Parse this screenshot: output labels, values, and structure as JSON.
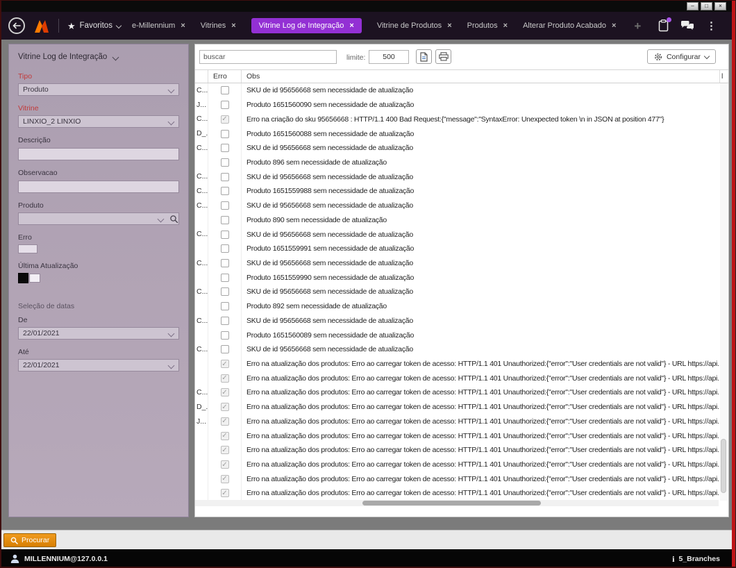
{
  "window": {
    "minimize": "–",
    "maximize": "□",
    "close": "×"
  },
  "colors": {
    "accent_purple": "#9330d4",
    "procurar_orange": "#e8890c",
    "edge_red": "#bd1518",
    "required_label_red": "#c23a3a"
  },
  "navbar": {
    "favorites_label": "Favoritos",
    "tabs": [
      {
        "label": "e-Millennium",
        "active": false
      },
      {
        "label": "Vitrines",
        "active": false
      },
      {
        "label": "Vitrine Log de Integração",
        "active": true
      },
      {
        "label": "Vitrine de Produtos",
        "active": false
      },
      {
        "label": "Produtos",
        "active": false
      },
      {
        "label": "Alterar Produto Acabado",
        "active": false
      }
    ],
    "add_tab": "+"
  },
  "sidebar": {
    "title": "Vitrine Log de Integração",
    "tipo": {
      "label": "Tipo",
      "value": "Produto"
    },
    "vitrine": {
      "label": "Vitrine",
      "value": "LINXIO_2 LINXIO"
    },
    "descricao": {
      "label": "Descrição",
      "value": ""
    },
    "observacao": {
      "label": "Observacao",
      "value": ""
    },
    "produto": {
      "label": "Produto",
      "value": ""
    },
    "erro": {
      "label": "Erro"
    },
    "ultima_atualizacao": {
      "label": "Última Atualização"
    },
    "date_section": {
      "title": "Seleção de datas",
      "de": {
        "label": "De",
        "value": "22/01/2021"
      },
      "ate": {
        "label": "Até",
        "value": "22/01/2021"
      }
    }
  },
  "toolbar": {
    "search_placeholder": "buscar",
    "limit_label": "limite:",
    "limit_value": "500",
    "configure_label": "Configurar"
  },
  "table": {
    "columns": {
      "c1": "",
      "erro": "Erro",
      "obs": "Obs",
      "right_stub": "l"
    },
    "rows": [
      {
        "c1": "C...",
        "erro": false,
        "obs": "SKU de id 95656668 sem necessidade de atualização"
      },
      {
        "c1": "J...",
        "erro": false,
        "obs": "Produto 1651560090 sem necessidade de atualização"
      },
      {
        "c1": "C...",
        "erro": true,
        "obs": "Erro na criação do sku 95656668 : HTTP/1.1 400 Bad Request:{\"message\":\"SyntaxError: Unexpected token \\n in JSON at position 477\"}"
      },
      {
        "c1": "D_...",
        "erro": false,
        "obs": "Produto 1651560088 sem necessidade de atualização"
      },
      {
        "c1": "C...",
        "erro": false,
        "obs": "SKU de id 95656668 sem necessidade de atualização"
      },
      {
        "c1": "",
        "erro": false,
        "obs": "Produto 896 sem necessidade de atualização"
      },
      {
        "c1": "C...",
        "erro": false,
        "obs": "SKU de id 95656668 sem necessidade de atualização"
      },
      {
        "c1": "C...",
        "erro": false,
        "obs": "Produto 1651559988 sem necessidade de atualização"
      },
      {
        "c1": "C...",
        "erro": false,
        "obs": "SKU de id 95656668 sem necessidade de atualização"
      },
      {
        "c1": "",
        "erro": false,
        "obs": "Produto 890 sem necessidade de atualização"
      },
      {
        "c1": "C...",
        "erro": false,
        "obs": "SKU de id 95656668 sem necessidade de atualização"
      },
      {
        "c1": "",
        "erro": false,
        "obs": "Produto 1651559991 sem necessidade de atualização"
      },
      {
        "c1": "C...",
        "erro": false,
        "obs": "SKU de id 95656668 sem necessidade de atualização"
      },
      {
        "c1": "",
        "erro": false,
        "obs": "Produto 1651559990 sem necessidade de atualização"
      },
      {
        "c1": "C...",
        "erro": false,
        "obs": "SKU de id 95656668 sem necessidade de atualização"
      },
      {
        "c1": "",
        "erro": false,
        "obs": "Produto 892 sem necessidade de atualização"
      },
      {
        "c1": "C...",
        "erro": false,
        "obs": "SKU de id 95656668 sem necessidade de atualização"
      },
      {
        "c1": "",
        "erro": false,
        "obs": "Produto 1651560089 sem necessidade de atualização"
      },
      {
        "c1": "C...",
        "erro": false,
        "obs": "SKU de id 95656668 sem necessidade de atualização"
      },
      {
        "c1": "",
        "erro": true,
        "obs": "Erro na atualização dos produtos: Erro ao carregar token de acesso: HTTP/1.1 401 Unauthorized:{\"error\":\"User credentials are not valid\"} - URL https://api.l..."
      },
      {
        "c1": "",
        "erro": true,
        "obs": "Erro na atualização dos produtos: Erro ao carregar token de acesso: HTTP/1.1 401 Unauthorized:{\"error\":\"User credentials are not valid\"} - URL https://api.l..."
      },
      {
        "c1": "C...",
        "erro": true,
        "obs": "Erro na atualização dos produtos: Erro ao carregar token de acesso: HTTP/1.1 401 Unauthorized:{\"error\":\"User credentials are not valid\"} - URL https://api.l..."
      },
      {
        "c1": "D_...",
        "erro": true,
        "obs": "Erro na atualização dos produtos: Erro ao carregar token de acesso: HTTP/1.1 401 Unauthorized:{\"error\":\"User credentials are not valid\"} - URL https://api.l..."
      },
      {
        "c1": "J...",
        "erro": true,
        "obs": "Erro na atualização dos produtos: Erro ao carregar token de acesso: HTTP/1.1 401 Unauthorized:{\"error\":\"User credentials are not valid\"} - URL https://api.l..."
      },
      {
        "c1": "",
        "erro": true,
        "obs": "Erro na atualização dos produtos: Erro ao carregar token de acesso: HTTP/1.1 401 Unauthorized:{\"error\":\"User credentials are not valid\"} - URL https://api.l..."
      },
      {
        "c1": "",
        "erro": true,
        "obs": "Erro na atualização dos produtos: Erro ao carregar token de acesso: HTTP/1.1 401 Unauthorized:{\"error\":\"User credentials are not valid\"} - URL https://api.l..."
      },
      {
        "c1": "",
        "erro": true,
        "obs": "Erro na atualização dos produtos: Erro ao carregar token de acesso: HTTP/1.1 401 Unauthorized:{\"error\":\"User credentials are not valid\"} - URL https://api.l..."
      },
      {
        "c1": "",
        "erro": true,
        "obs": "Erro na atualização dos produtos: Erro ao carregar token de acesso: HTTP/1.1 401 Unauthorized:{\"error\":\"User credentials are not valid\"} - URL https://api.l..."
      },
      {
        "c1": "",
        "erro": true,
        "obs": "Erro na atualização dos produtos: Erro ao carregar token de acesso: HTTP/1.1 401 Unauthorized:{\"error\":\"User credentials are not valid\"} - URL https://api.l..."
      }
    ]
  },
  "footer": {
    "procurar_label": "Procurar",
    "status_user": "MILLENNIUM@127.0.0.1",
    "status_branches": "5_Branches"
  }
}
